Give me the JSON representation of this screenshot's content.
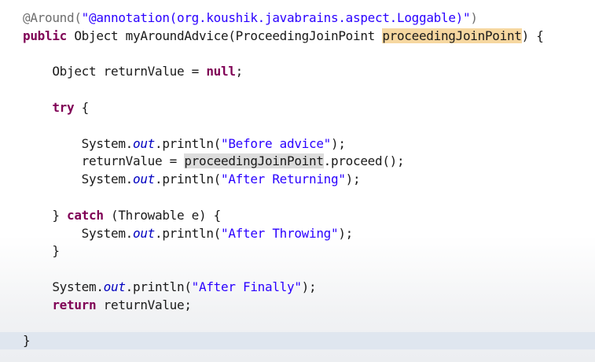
{
  "editor": {
    "lines": [
      [
        {
          "t": "@Around(",
          "c": "ann"
        },
        {
          "t": "\"@annotation(org.koushik.javabrains.aspect.Loggable)\"",
          "c": "str"
        },
        {
          "t": ")",
          "c": "ann"
        }
      ],
      [
        {
          "t": "public",
          "c": "kw"
        },
        {
          "t": " Object myAroundAdvice(ProceedingJoinPoint "
        },
        {
          "t": "proceedingJoinPoint",
          "c": "hl-occ"
        },
        {
          "t": ") {"
        }
      ],
      [],
      [
        {
          "t": "    Object returnValue = "
        },
        {
          "t": "null",
          "c": "kw"
        },
        {
          "t": ";"
        }
      ],
      [],
      [
        {
          "t": "    "
        },
        {
          "t": "try",
          "c": "kw"
        },
        {
          "t": " {"
        }
      ],
      [],
      [
        {
          "t": "        System."
        },
        {
          "t": "out",
          "c": "field"
        },
        {
          "t": ".println("
        },
        {
          "t": "\"Before advice\"",
          "c": "str"
        },
        {
          "t": ");"
        }
      ],
      [
        {
          "t": "        returnValue = "
        },
        {
          "t": "proceedingJoinPoint",
          "c": "hl-read"
        },
        {
          "t": ".proceed();"
        }
      ],
      [
        {
          "t": "        System."
        },
        {
          "t": "out",
          "c": "field"
        },
        {
          "t": ".println("
        },
        {
          "t": "\"After Returning\"",
          "c": "str"
        },
        {
          "t": ");"
        }
      ],
      [],
      [
        {
          "t": "    } "
        },
        {
          "t": "catch",
          "c": "kw"
        },
        {
          "t": " (Throwable e) {"
        }
      ],
      [
        {
          "t": "        System."
        },
        {
          "t": "out",
          "c": "field"
        },
        {
          "t": ".println("
        },
        {
          "t": "\"After Throwing\"",
          "c": "str"
        },
        {
          "t": ");"
        }
      ],
      [
        {
          "t": "    }"
        }
      ],
      [],
      [
        {
          "t": "    System."
        },
        {
          "t": "out",
          "c": "field"
        },
        {
          "t": ".println("
        },
        {
          "t": "\"After Finally\"",
          "c": "str"
        },
        {
          "t": ");"
        }
      ],
      [
        {
          "t": "    "
        },
        {
          "t": "return",
          "c": "kw"
        },
        {
          "t": " returnValue;"
        }
      ],
      [],
      [
        {
          "t": "}"
        }
      ]
    ],
    "current_line": 19,
    "colors": {
      "keyword": "#7f0055",
      "string": "#2a00ff",
      "annotation": "#6e6e6e",
      "field": "#0000c0",
      "occurrence_highlight": "#f6d7a0",
      "read_highlight": "#dcdcdc",
      "current_line": "#dfe6ef"
    }
  }
}
